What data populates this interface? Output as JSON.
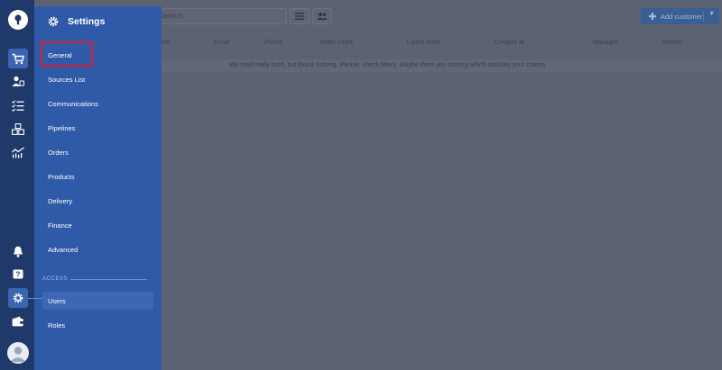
{
  "toolbar": {
    "search_placeholder": "Search",
    "add_button_label": "Add customer",
    "list_icon": "list-icon",
    "group_icon": "users-icon"
  },
  "table": {
    "columns": [
      "Name",
      "Email",
      "Phone",
      "Order count",
      "Latest order",
      "Created at",
      "Manager",
      "Actions"
    ],
    "sorted_column": "Created at",
    "empty_message": "We tried really hard, but found nothing. Please, check filters. Maybe there are nothing which satisfies your criteria"
  },
  "rail": {
    "items": [
      "logo-icon",
      "cart-icon",
      "customers-icon",
      "tasks-icon",
      "boxes-icon",
      "analytics-icon",
      "bell-icon",
      "help-icon",
      "settings-icon",
      "wallet-icon",
      "avatar"
    ],
    "active": [
      "cart-icon",
      "settings-icon"
    ]
  },
  "settings": {
    "title": "Settings",
    "items": [
      "General",
      "Sources List",
      "Communications",
      "Pipelines",
      "Orders",
      "Products",
      "Delivery",
      "Finance",
      "Advanced"
    ],
    "access_label": "ACCESS",
    "access_items": [
      "Users",
      "Roles"
    ],
    "highlighted": "General",
    "active": "Users"
  },
  "colors": {
    "panel": "#2f5aa8",
    "rail": "#1f3a6a",
    "highlight_border": "#d6202b",
    "overlay": "#5c6271"
  }
}
